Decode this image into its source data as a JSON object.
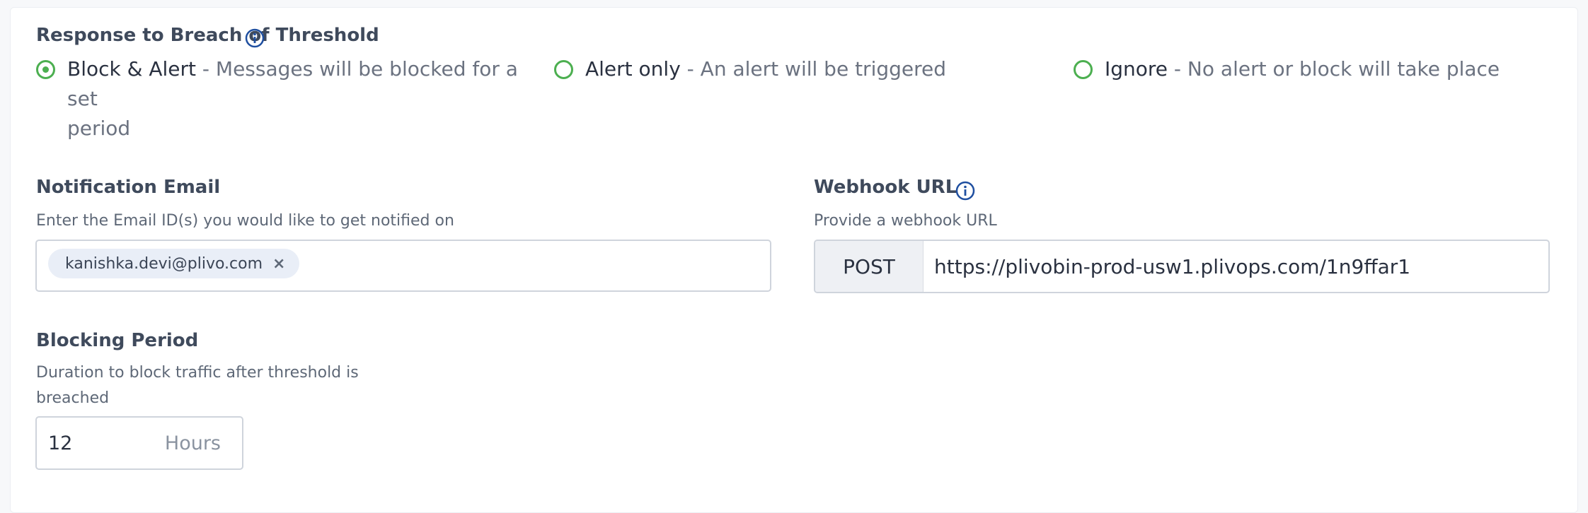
{
  "response": {
    "title": "Response to Breach of Threshold",
    "options": [
      {
        "label": "Block & Alert",
        "description": " - Messages will be blocked for a set",
        "description_cont": "period",
        "selected": true
      },
      {
        "label": "Alert only",
        "description": " - An alert will be triggered",
        "selected": false
      },
      {
        "label": "Ignore",
        "description": " - No alert or block will take place",
        "selected": false
      }
    ]
  },
  "notification_email": {
    "title": "Notification Email",
    "help": "Enter the Email ID(s) you would like to get notified on",
    "chips": [
      "kanishka.devi@plivo.com"
    ],
    "remove_glyph": "×"
  },
  "webhook": {
    "title": "Webhook URL",
    "help": "Provide a webhook URL",
    "method": "POST",
    "url": "https://plivobin-prod-usw1.plivops.com/1n9ffar1"
  },
  "blocking_period": {
    "title": "Blocking Period",
    "help_line1": "Duration to block traffic after threshold is",
    "help_line2": "breached",
    "value": "12",
    "unit": "Hours"
  },
  "colors": {
    "accent_green": "#4caf50",
    "info_blue": "#1f4fa0",
    "chip_bg": "#e9eef7"
  },
  "icons": {
    "info": "info-icon",
    "remove": "close-icon"
  }
}
